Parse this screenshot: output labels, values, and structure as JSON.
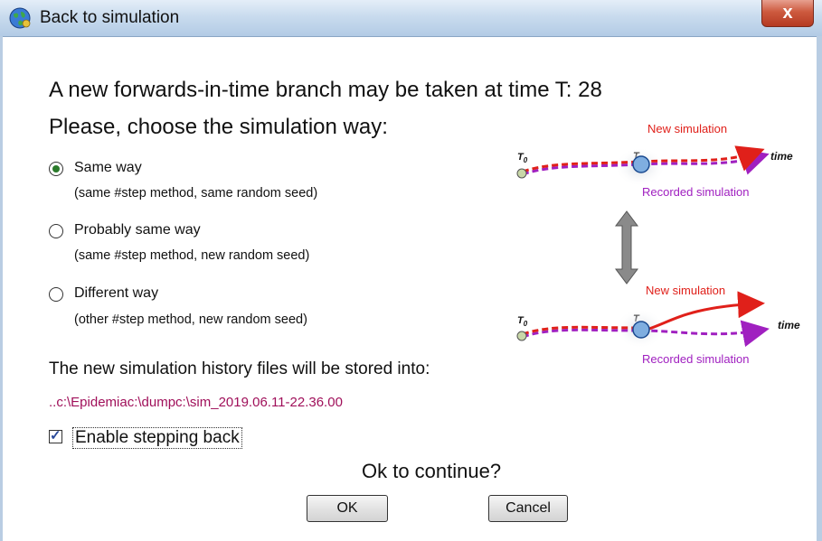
{
  "window": {
    "title": "Back to simulation",
    "close_label": "x"
  },
  "header": {
    "line1": "A new forwards-in-time branch may be taken at time T: 28",
    "line2": "Please, choose the simulation way:"
  },
  "options": [
    {
      "label": "Same way",
      "sub": "(same #step method, same random seed)",
      "selected": true
    },
    {
      "label": "Probably same way",
      "sub": "(same #step method, new random seed)",
      "selected": false
    },
    {
      "label": "Different way",
      "sub": "(other #step method, new random seed)",
      "selected": false
    }
  ],
  "storage": {
    "text": "The new simulation history files will be stored into:",
    "path": "..c:\\Epidemiac:\\dumpc:\\sim_2019.06.11-22.36.00"
  },
  "stepping": {
    "label": "Enable stepping back",
    "checked": true
  },
  "prompt": "Ok to continue?",
  "buttons": {
    "ok": "OK",
    "cancel": "Cancel"
  },
  "diagram": {
    "top": {
      "new_label": "New simulation",
      "recorded_label": "Recorded simulation",
      "t0": "T",
      "t0_sub": "0",
      "t": "T",
      "time": "time"
    },
    "bottom": {
      "new_label": "New simulation",
      "recorded_label": "Recorded simulation",
      "t0": "T",
      "t0_sub": "0",
      "t": "T",
      "time": "time"
    }
  },
  "colors": {
    "new_simulation": "#e0201a",
    "recorded_simulation": "#a020c0",
    "path_text": "#a0105a"
  }
}
